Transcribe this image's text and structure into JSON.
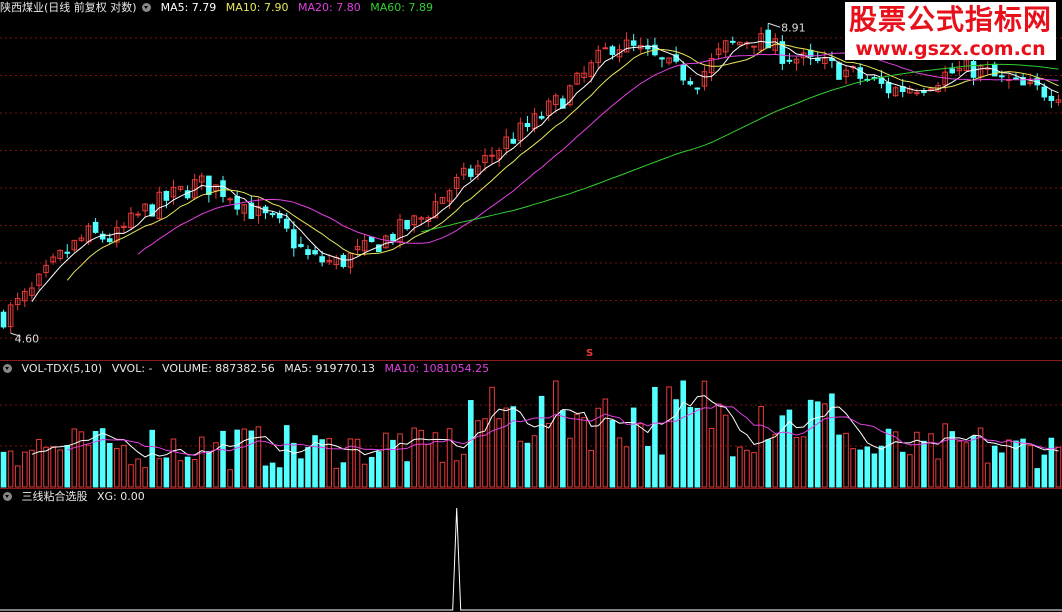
{
  "main": {
    "title": "陕西煤业(日线 前复权 对数)",
    "ma5": "MA5: 7.79",
    "ma10": "MA10: 7.90",
    "ma20": "MA20: 7.80",
    "ma60": "MA60: 7.89",
    "high_label": "8.91",
    "low_label": "4.60",
    "signal_mark": "S"
  },
  "volume": {
    "title": "VOL-TDX(5,10)",
    "vvol": "VVOL: -",
    "volume": "VOLUME: 887382.56",
    "ma5": "MA5: 919770.13",
    "ma10": "MA10: 1081054.25"
  },
  "indicator": {
    "title": "三线粘合选股",
    "xg": "XG: 0.00"
  },
  "watermark": {
    "line1": "股票公式指标网",
    "line2": "www.gszx.com.cn"
  },
  "colors": {
    "up": "#e83a3a",
    "down": "#54ffff",
    "ma5": "#ffffff",
    "ma10": "#e8e85a",
    "ma20": "#e040e0",
    "ma60": "#30d030",
    "grid": "#7a1010"
  },
  "chart_data": [
    {
      "type": "candlestick",
      "title": "陕西煤业(日线 前复权 对数)",
      "log_scale": true,
      "y_range": [
        4.4,
        9.2
      ],
      "annotations": [
        {
          "text": "8.91",
          "type": "high"
        },
        {
          "text": "4.60",
          "type": "low"
        }
      ],
      "close_path": [
        4.65,
        4.9,
        5.3,
        5.6,
        5.55,
        5.9,
        6.1,
        6.3,
        6.2,
        5.9,
        5.7,
        5.3,
        5.25,
        5.4,
        5.6,
        5.8,
        6.2,
        6.5,
        6.9,
        7.2,
        7.6,
        8.1,
        8.7,
        8.5,
        8.2,
        8.0,
        8.6,
        8.8,
        8.5,
        8.3,
        8.2,
        8.0,
        7.8,
        7.9,
        8.1,
        8.2,
        7.95,
        7.8,
        7.79
      ],
      "series": [
        {
          "name": "MA5",
          "last": 7.79
        },
        {
          "name": "MA10",
          "last": 7.9
        },
        {
          "name": "MA20",
          "last": 7.8
        },
        {
          "name": "MA60",
          "last": 7.89
        }
      ]
    },
    {
      "type": "bar",
      "title": "VOL-TDX(5,10)",
      "series": [
        {
          "name": "VOLUME",
          "last": 887382.56
        },
        {
          "name": "MA5",
          "last": 919770.13
        },
        {
          "name": "MA10",
          "last": 1081054.25
        }
      ]
    },
    {
      "type": "line",
      "title": "三线粘合选股",
      "series": [
        {
          "name": "XG",
          "last": 0.0,
          "signal_bars": [
            64
          ]
        }
      ]
    }
  ]
}
